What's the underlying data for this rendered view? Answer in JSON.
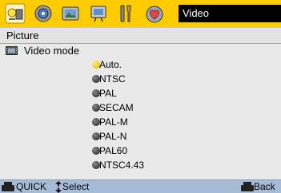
{
  "tabs": [
    {
      "icon": "picture-adjust-icon",
      "active": true
    },
    {
      "icon": "audio-disc-icon",
      "active": false
    },
    {
      "icon": "image-display-icon",
      "active": false
    },
    {
      "icon": "setup-screen-icon",
      "active": false
    },
    {
      "icon": "tools-icon",
      "active": false
    },
    {
      "icon": "options-heart-icon",
      "active": false
    }
  ],
  "menu_title": "Video",
  "section": {
    "label": "Picture"
  },
  "menu_item": {
    "label": "Video mode",
    "icon": "video-mode-icon"
  },
  "options": [
    {
      "label": "Auto.",
      "selected": true
    },
    {
      "label": "NTSC",
      "selected": false
    },
    {
      "label": "PAL",
      "selected": false
    },
    {
      "label": "SECAM",
      "selected": false
    },
    {
      "label": "PAL-M",
      "selected": false
    },
    {
      "label": "PAL-N",
      "selected": false
    },
    {
      "label": "PAL60",
      "selected": false
    },
    {
      "label": "NTSC4.43",
      "selected": false
    }
  ],
  "help": {
    "quick_label": "QUICK",
    "select_label": "Select",
    "back_label": "Back"
  },
  "colors": {
    "tab_bar": "#ffcc00",
    "selected_dot": "#f4c400",
    "help_bar": "#a6bcd6"
  }
}
